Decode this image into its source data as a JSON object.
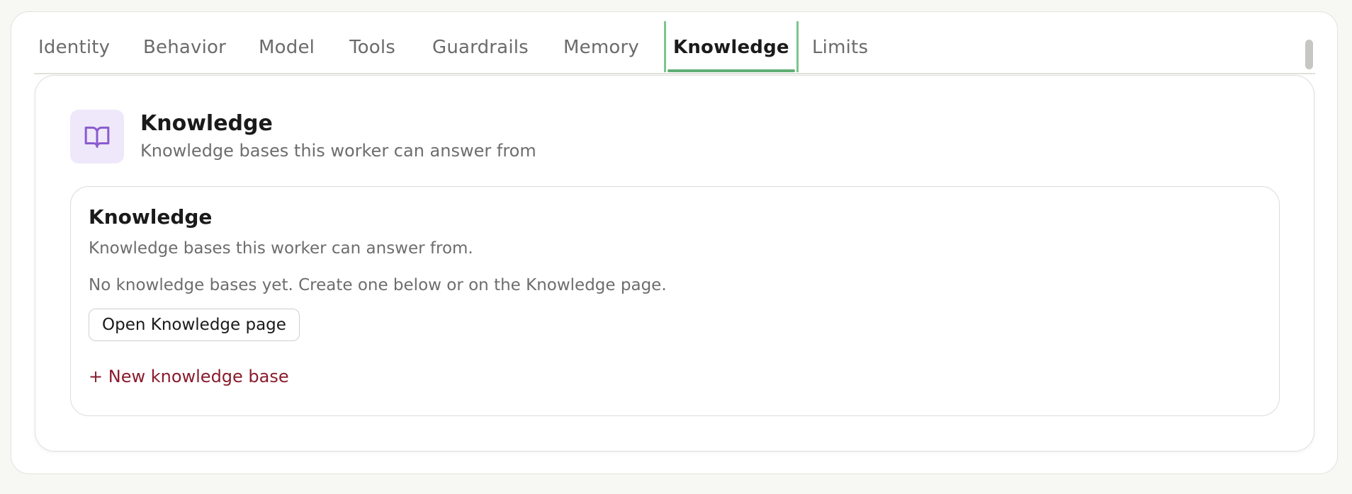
{
  "tabs": [
    {
      "label": "Identity"
    },
    {
      "label": "Behavior"
    },
    {
      "label": "Model"
    },
    {
      "label": "Tools"
    },
    {
      "label": "Guardrails"
    },
    {
      "label": "Memory"
    },
    {
      "label": "Knowledge",
      "active": true
    },
    {
      "label": "Limits"
    }
  ],
  "section": {
    "icon": "book-open-icon",
    "title": "Knowledge",
    "subtitle": "Knowledge bases this worker can answer from"
  },
  "card": {
    "title": "Knowledge",
    "description": "Knowledge bases this worker can answer from.",
    "empty_message": "No knowledge bases yet. Create one below or on the Knowledge page.",
    "open_button": "Open Knowledge page",
    "new_link": "+ New knowledge base"
  },
  "colors": {
    "active_tab_accent": "#5fae74",
    "icon_bg": "#efe8fa",
    "icon_stroke": "#8a5cd0",
    "new_link": "#8a1b2c"
  }
}
